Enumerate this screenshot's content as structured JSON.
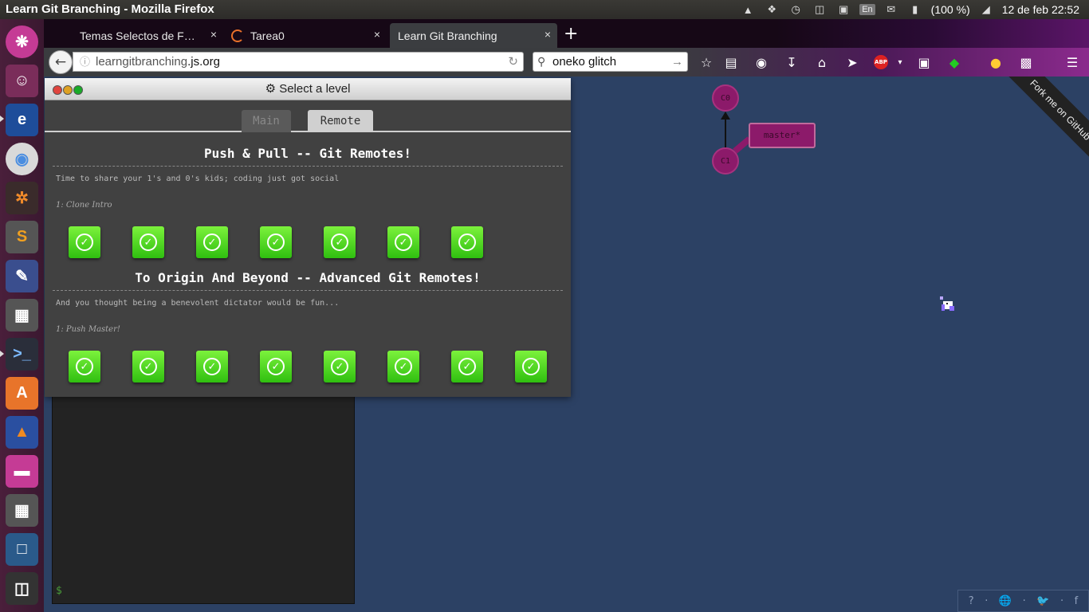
{
  "system": {
    "window_title": "Learn Git Branching - Mozilla Firefox",
    "battery": "(100 %)",
    "keyboard": "En",
    "datetime": "12 de feb 22:52"
  },
  "browser": {
    "tabs": [
      {
        "label": "Temas Selectos de F…",
        "close": "×"
      },
      {
        "label": "Tarea0",
        "close": "×"
      },
      {
        "label": "Learn Git Branching",
        "close": "×"
      }
    ],
    "new_tab": "+",
    "url_plain": "learngitbranching",
    "url_domain": ".js.org",
    "search_value": "oneko glitch",
    "abp": "ABP"
  },
  "dialog": {
    "title": "Select a level",
    "tabs": [
      "Main",
      "Remote"
    ],
    "sections": [
      {
        "title": "Push & Pull -- Git Remotes!",
        "description": "Time to share your 1's and 0's kids; coding just got social",
        "level_name": "1: Clone Intro",
        "level_count": 7
      },
      {
        "title": "To Origin And Beyond -- Advanced Git Remotes!",
        "description": "And you thought being a benevolent dictator would be fun...",
        "level_name": "1: Push Master!",
        "level_count": 8
      }
    ]
  },
  "terminal": {
    "prompt": "$"
  },
  "graph": {
    "nodes": [
      "C0",
      "C1"
    ],
    "branch": "master*"
  },
  "ribbon": "Fork me on GitHub",
  "footer_links": [
    "?",
    "·",
    "🌐",
    "·",
    "🐦",
    "·",
    "f"
  ],
  "colors": {
    "node": "#8c1a6a",
    "level_done": "#3fd01a",
    "page_bg": "#2c4164"
  }
}
